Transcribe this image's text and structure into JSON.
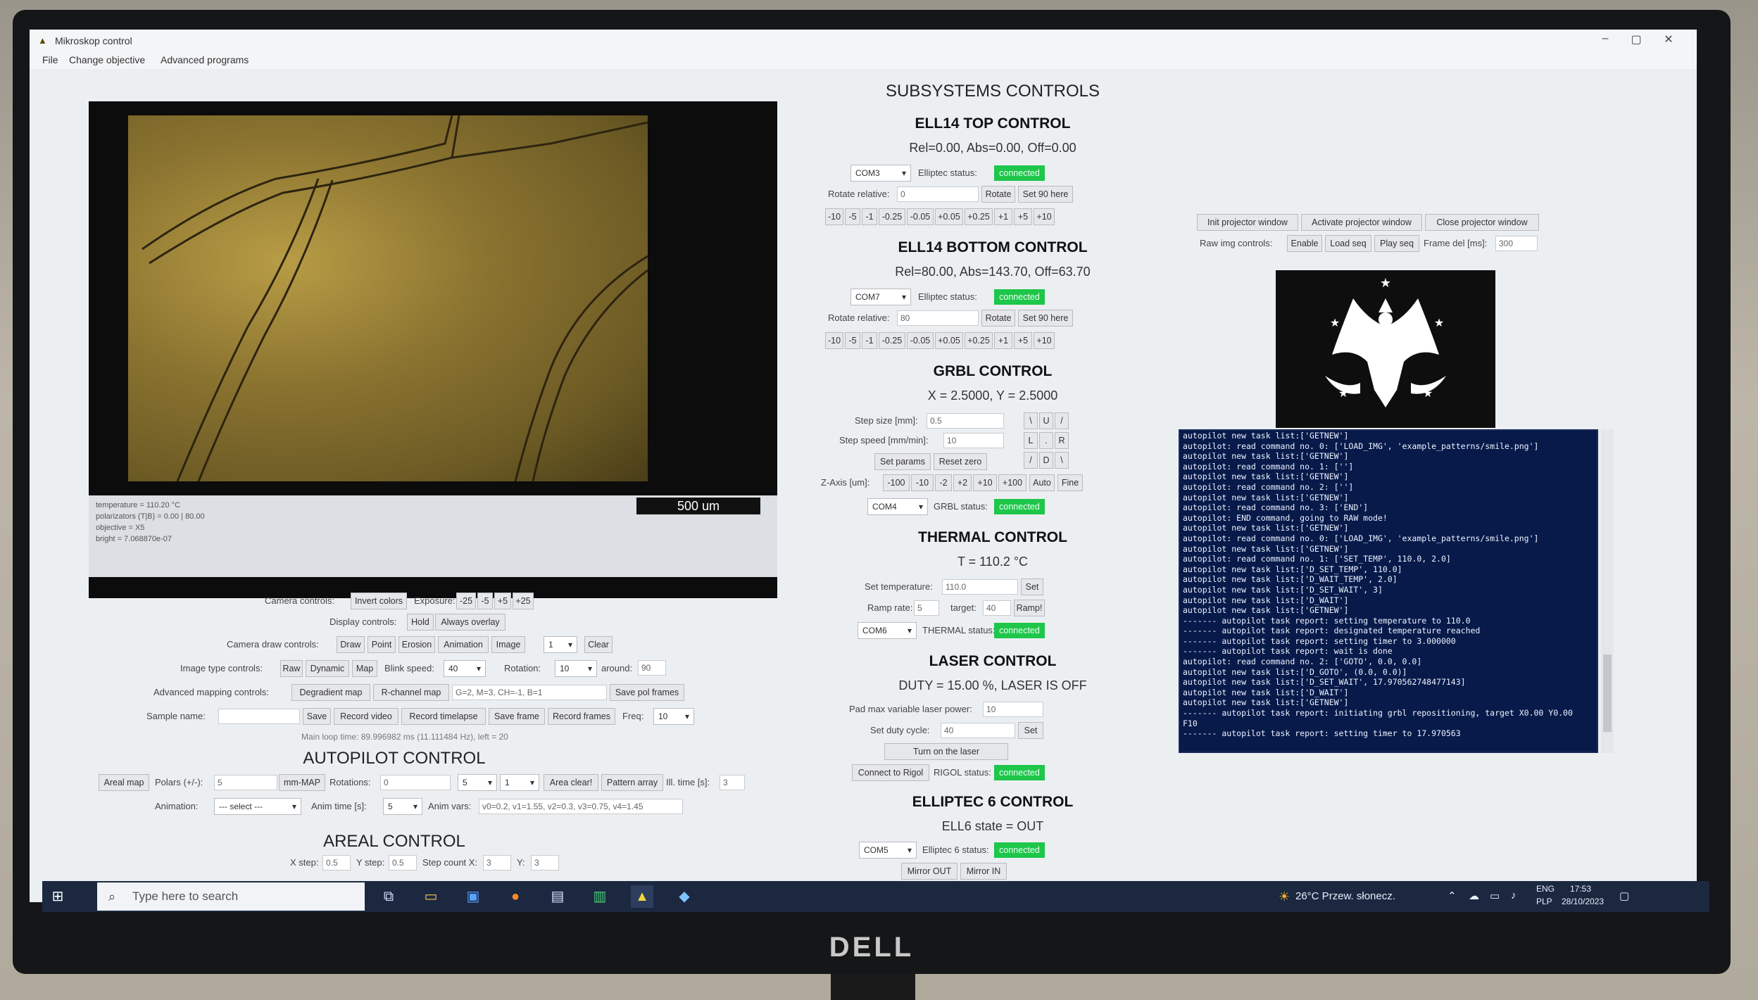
{
  "window": {
    "title": "Mikroskop control",
    "minimize": "–",
    "maximize": "▢",
    "close": "✕"
  },
  "menu": [
    "File",
    "Change objective",
    "Advanced programs"
  ],
  "video": {
    "info": [
      "temperature = 110.20 °C",
      "polarizators (T|B) = 0.00 | 80.00",
      "objective = X5",
      "bright = 7.068870e-07"
    ],
    "scale": "500 um"
  },
  "camera": {
    "camera_controls": "Camera controls:",
    "invert": "Invert colors",
    "exposure": "Exposure:",
    "exp_btns": [
      "-25",
      "-5",
      "+5",
      "+25"
    ],
    "display_controls": "Display controls:",
    "hold": "Hold",
    "always_overlay": "Always overlay",
    "draw_controls": "Camera draw controls:",
    "draw_btns": [
      "Draw",
      "Point",
      "Erosion",
      "Animation",
      "Image"
    ],
    "draw_sel": "1",
    "clear": "Clear",
    "image_type": "Image type controls:",
    "type_btns": [
      "Raw",
      "Dynamic",
      "Map"
    ],
    "blink": "Blink speed:",
    "blink_val": "40",
    "rotation": "Rotation:",
    "rotation_val": "10",
    "around": "around:",
    "around_val": "90",
    "adv_mapping": "Advanced mapping controls:",
    "degradient": "Degradient map",
    "rchannel": "R-channel map",
    "formula": "G=2, M=3, CH=-1, B=1",
    "save_pol": "Save pol frames",
    "sample": "Sample name:",
    "save": "Save",
    "record_video": "Record video",
    "record_timelapse": "Record timelapse",
    "save_frame": "Save frame",
    "record_frames": "Record frames",
    "freq": "Freq:",
    "freq_val": "10",
    "loop": "Main loop time: 89.996982 ms (11.111484 Hz), left = 20"
  },
  "autopilot": {
    "title": "AUTOPILOT CONTROL",
    "areal_map": "Areal map",
    "polars": "Polars (+/-):",
    "polars_val": "5",
    "mm_map": "mm-MAP",
    "rotations": "Rotations:",
    "rotations_val": "0",
    "sel1": "5",
    "sel2": "1",
    "area_clear": "Area clear!",
    "pattern_array": "Pattern array",
    "time": "Ill. time [s]:",
    "time_val": "3",
    "animation": "Animation:",
    "anim_sel": "--- select ---",
    "anim_time": "Anim time [s]:",
    "anim_time_val": "5",
    "anim_vars": "Anim vars:",
    "anim_vars_val": "v0=0.2, v1=1.55, v2=0.3, v3=0.75, v4=1.45"
  },
  "areal": {
    "title": "AREAL CONTROL",
    "xstep": "X step:",
    "xstep_val": "0.5",
    "ystep": "Y step:",
    "ystep_val": "0.5",
    "count_x": "Step count X:",
    "count_x_val": "3",
    "y": "Y:",
    "y_val": "3"
  },
  "subsystems": "SUBSYSTEMS CONTROLS",
  "ell_top": {
    "title": "ELL14 TOP CONTROL",
    "state": "Rel=0.00, Abs=0.00, Off=0.00",
    "com": "COM3",
    "status_label": "Elliptec status:",
    "status": "connected",
    "rotate_rel": "Rotate relative:",
    "rotate_val": "0",
    "rotate": "Rotate",
    "set90": "Set 90 here",
    "steps": [
      "-10",
      "-5",
      "-1",
      "-0.25",
      "-0.05",
      "+0.05",
      "+0.25",
      "+1",
      "+5",
      "+10"
    ]
  },
  "ell_bottom": {
    "title": "ELL14 BOTTOM CONTROL",
    "state": "Rel=80.00, Abs=143.70, Off=63.70",
    "com": "COM7",
    "status_label": "Elliptec status:",
    "status": "connected",
    "rotate_rel": "Rotate relative:",
    "rotate_val": "80",
    "rotate": "Rotate",
    "set90": "Set 90 here",
    "steps": [
      "-10",
      "-5",
      "-1",
      "-0.25",
      "-0.05",
      "+0.05",
      "+0.25",
      "+1",
      "+5",
      "+10"
    ]
  },
  "grbl": {
    "title": "GRBL CONTROL",
    "state": "X = 2.5000, Y = 2.5000",
    "step_size": "Step size [mm]:",
    "step_size_val": "0.5",
    "step_speed": "Step speed [mm/min]:",
    "step_speed_val": "10",
    "set_params": "Set params",
    "reset_zero": "Reset zero",
    "arrows": [
      "\\",
      "U",
      "/",
      "L",
      ".",
      "R",
      "/",
      "D",
      "\\"
    ],
    "zaxis": "Z-Axis [um]:",
    "z_btns": [
      "-100",
      "-10",
      "-2",
      "+2",
      "+10",
      "+100"
    ],
    "auto": "Auto",
    "fine": "Fine",
    "com": "COM4",
    "status_label": "GRBL status:",
    "status": "connected"
  },
  "thermal": {
    "title": "THERMAL CONTROL",
    "state": "T = 110.2 °C",
    "set_temp": "Set temperature:",
    "set_temp_val": "110.0",
    "set": "Set",
    "ramp_rate": "Ramp rate:",
    "ramp_rate_val": "5",
    "target": "target:",
    "target_val": "40",
    "ramp": "Ramp!",
    "com": "COM6",
    "status_label": "THERMAL status:",
    "status": "connected"
  },
  "laser": {
    "title": "LASER CONTROL",
    "state": "DUTY = 15.00 %, LASER IS OFF",
    "pad_max": "Pad max variable laser power:",
    "pad_max_val": "10",
    "duty": "Set duty cycle:",
    "duty_val": "40",
    "set": "Set",
    "turn_on": "Turn on the laser",
    "connect": "Connect to Rigol",
    "status_label": "RIGOL status:",
    "status": "connected"
  },
  "ell6": {
    "title": "ELLIPTEC 6 CONTROL",
    "state": "ELL6 state = OUT",
    "com": "COM5",
    "status_label": "Elliptec 6 status:",
    "status": "connected",
    "mirror_out": "Mirror OUT",
    "mirror_in": "Mirror IN"
  },
  "projector": {
    "init": "Init projector window",
    "activate": "Activate projector window",
    "close": "Close projector window",
    "raw_img": "Raw img controls:",
    "enable": "Enable",
    "load_seq": "Load seq",
    "play_seq": "Play seq",
    "frame_del": "Frame del [ms]:",
    "frame_del_val": "300"
  },
  "console": [
    "autopilot new task list:['GETNEW']",
    "autopilot: read command no. 0: ['LOAD_IMG', 'example_patterns/smile.png']",
    "autopilot new task list:['GETNEW']",
    "autopilot: read command no. 1: ['']",
    "autopilot new task list:['GETNEW']",
    "autopilot: read command no. 2: ['']",
    "autopilot new task list:['GETNEW']",
    "autopilot: read command no. 3: ['END']",
    "autopilot: END command, going to RAW mode!",
    "autopilot new task list:['GETNEW']",
    "autopilot: read command no. 0: ['LOAD_IMG', 'example_patterns/smile.png']",
    "autopilot new task list:['GETNEW']",
    "autopilot: read command no. 1: ['SET_TEMP', 110.0, 2.0]",
    "autopilot new task list:['D_SET_TEMP', 110.0]",
    "autopilot new task list:['D_WAIT_TEMP', 2.0]",
    "autopilot new task list:['D_SET_WAIT', 3]",
    "autopilot new task list:['D_WAIT']",
    "autopilot new task list:['GETNEW']",
    "------- autopilot task report: setting temperature to 110.0",
    "------- autopilot task report: designated temperature reached",
    "------- autopilot task report: setting timer to 3.000000",
    "------- autopilot task report: wait is done",
    "autopilot: read command no. 2: ['GOTO', 0.0, 0.0]",
    "autopilot new task list:['D_GOTO', (0.0, 0.0)]",
    "autopilot new task list:['D_SET_WAIT', 17.970562748477143]",
    "autopilot new task list:['D_WAIT']",
    "autopilot new task list:['GETNEW']",
    "------- autopilot task report: initiating grbl repositioning, target X0.00 Y0.00",
    "F10",
    "------- autopilot task report: setting timer to 17.970563"
  ],
  "taskbar": {
    "search": "Type here to search",
    "weather": "26°C  Przew. słonecz.",
    "lang1": "ENG",
    "lang2": "PLP",
    "time": "17:53",
    "date": "28/10/2023"
  }
}
